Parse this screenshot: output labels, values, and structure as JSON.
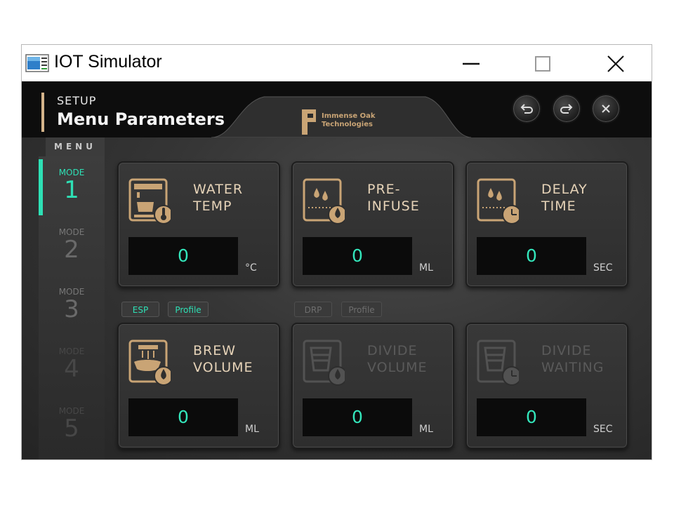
{
  "window": {
    "title": "IOT Simulator"
  },
  "header": {
    "setup_label": "SETUP",
    "title": "Menu Parameters",
    "logo_line1": "Immense Oak",
    "logo_line2": "Technologies"
  },
  "menu": {
    "label": "MENU",
    "modes": [
      {
        "sub": "MODE",
        "num": "1"
      },
      {
        "sub": "MODE",
        "num": "2"
      },
      {
        "sub": "MODE",
        "num": "3"
      },
      {
        "sub": "MODE",
        "num": "4"
      },
      {
        "sub": "MODE",
        "num": "5"
      }
    ]
  },
  "cards": {
    "water_temp": {
      "line1": "WATER",
      "line2": "TEMP",
      "value": "0",
      "unit": "°C"
    },
    "pre_infuse": {
      "line1": "PRE-",
      "line2": "INFUSE",
      "value": "0",
      "unit": "ML"
    },
    "delay_time": {
      "line1": "DELAY",
      "line2": "TIME",
      "value": "0",
      "unit": "SEC"
    },
    "brew_volume": {
      "line1": "BREW",
      "line2": "VOLUME",
      "value": "0",
      "unit": "ML"
    },
    "divide_volume": {
      "line1": "DIVIDE",
      "line2": "VOLUME",
      "value": "0",
      "unit": "ML"
    },
    "divide_waiting": {
      "line1": "DIVIDE",
      "line2": "WAITING",
      "value": "0",
      "unit": "SEC"
    }
  },
  "tags": {
    "esp": "ESP",
    "esp_profile": "Profile",
    "drp": "DRP",
    "drp_profile": "Profile"
  },
  "colors": {
    "accent": "#2ee0b5",
    "gold": "#d4b48a",
    "value": "#33e6bb"
  }
}
